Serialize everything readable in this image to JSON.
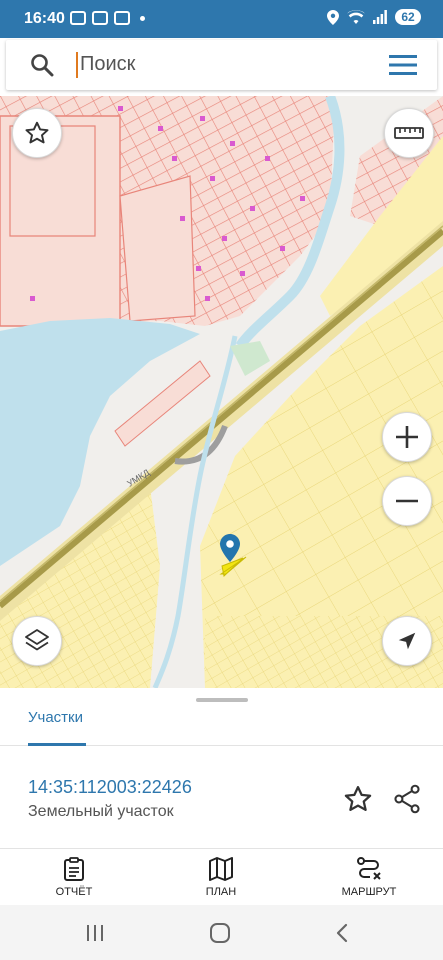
{
  "status_bar": {
    "time": "16:40",
    "battery": "62"
  },
  "search": {
    "placeholder": "Поиск"
  },
  "map": {
    "road_label": "УМКД"
  },
  "sheet": {
    "tab_label": "Участки",
    "cadastral_number": "14:35:112003:22426",
    "parcel_type": "Земельный участок"
  },
  "bottom_nav": {
    "items": [
      {
        "label": "ОТЧЁТ",
        "icon": "report-icon"
      },
      {
        "label": "ПЛАН",
        "icon": "map-plan-icon"
      },
      {
        "label": "МАРШРУТ",
        "icon": "route-icon"
      }
    ]
  },
  "colors": {
    "accent": "#2e77ad",
    "parcel_outline": "#e8857a",
    "parcel_fill": "#f8ddd6",
    "zone_fill": "#fbf0b2",
    "water": "#bfe0ec",
    "highway": "#a79a49",
    "marker": "#2375ad",
    "selected_parcel": "#f2e512"
  }
}
